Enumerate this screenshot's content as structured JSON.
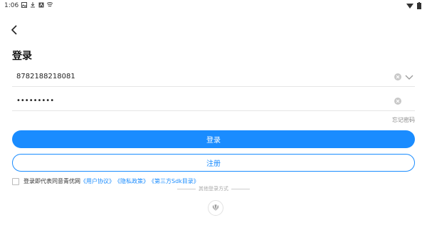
{
  "status_bar": {
    "time": "1:06"
  },
  "page": {
    "title": "登录"
  },
  "account": {
    "value": "8782188218081"
  },
  "password": {
    "value": "•••••••••"
  },
  "forgot_password": "忘记密码",
  "buttons": {
    "login": "登录",
    "register": "注册"
  },
  "agreement": {
    "prefix": "登录即代表同意青优网",
    "user_agreement": "《用户协议》",
    "privacy_policy": "《隐私政策》",
    "third_party_sdk": "《第三方Sdk目录》"
  },
  "other_login": {
    "label": "其他登录方式"
  },
  "colors": {
    "accent": "#1a8cff"
  },
  "icons": [
    "back-icon",
    "clear-icon",
    "chevron-down-icon",
    "huawei-logo-icon",
    "wifi-icon",
    "battery-icon"
  ]
}
